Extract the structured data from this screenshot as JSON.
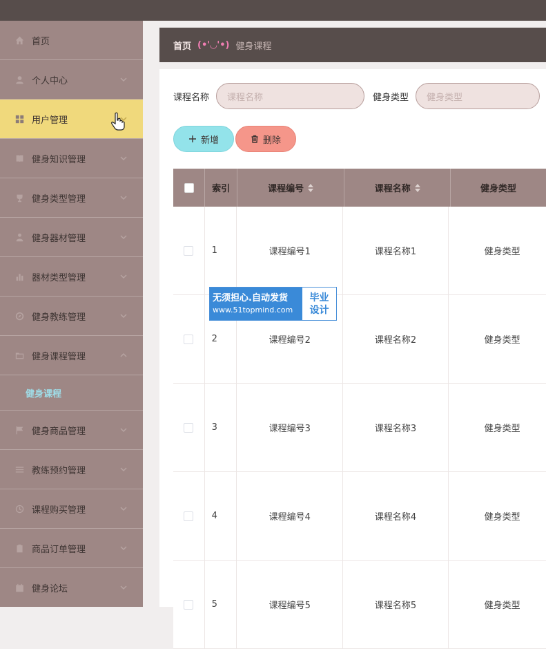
{
  "sidebar": {
    "items": [
      {
        "label": "首页",
        "icon": "home-icon"
      },
      {
        "label": "个人中心",
        "icon": "user-icon"
      },
      {
        "label": "用户管理",
        "icon": "grid-icon"
      },
      {
        "label": "健身知识管理",
        "icon": "book-icon"
      },
      {
        "label": "健身类型管理",
        "icon": "trophy-icon"
      },
      {
        "label": "健身器材管理",
        "icon": "person-icon"
      },
      {
        "label": "器材类型管理",
        "icon": "bar-chart-icon"
      },
      {
        "label": "健身教练管理",
        "icon": "compass-icon"
      },
      {
        "label": "健身课程管理",
        "icon": "folder-icon"
      },
      {
        "label": "健身商品管理",
        "icon": "flag-icon"
      },
      {
        "label": "教练预约管理",
        "icon": "list-icon"
      },
      {
        "label": "课程购买管理",
        "icon": "clock-icon"
      },
      {
        "label": "商品订单管理",
        "icon": "clipboard-icon"
      },
      {
        "label": "健身论坛",
        "icon": "calendar-icon"
      }
    ],
    "submenu_label": "健身课程",
    "active_color": "#f0d97c",
    "submenu_color": "#9fdde8"
  },
  "breadcrumb": {
    "home": "首页",
    "separator": "(•'◡'•)",
    "current": "健身课程"
  },
  "search": {
    "course_name_label": "课程名称",
    "course_name_placeholder": "课程名称",
    "fitness_type_label": "健身类型",
    "fitness_type_placeholder": "健身类型"
  },
  "actions": {
    "add_label": "新增",
    "delete_label": "删除"
  },
  "table": {
    "headers": {
      "index": "索引",
      "code": "课程编号",
      "name": "课程名称",
      "type": "健身类型"
    },
    "rows": [
      {
        "index": "1",
        "code": "课程编号1",
        "name": "课程名称1",
        "type": "健身类型"
      },
      {
        "index": "2",
        "code": "课程编号2",
        "name": "课程名称2",
        "type": "健身类型"
      },
      {
        "index": "3",
        "code": "课程编号3",
        "name": "课程名称3",
        "type": "健身类型"
      },
      {
        "index": "4",
        "code": "课程编号4",
        "name": "课程名称4",
        "type": "健身类型"
      },
      {
        "index": "5",
        "code": "课程编号5",
        "name": "课程名称5",
        "type": "健身类型"
      }
    ]
  },
  "watermark": {
    "line1": "无须担心.自动发货",
    "line2": "www.51topmind.com",
    "right1": "毕业",
    "right2": "设计"
  }
}
